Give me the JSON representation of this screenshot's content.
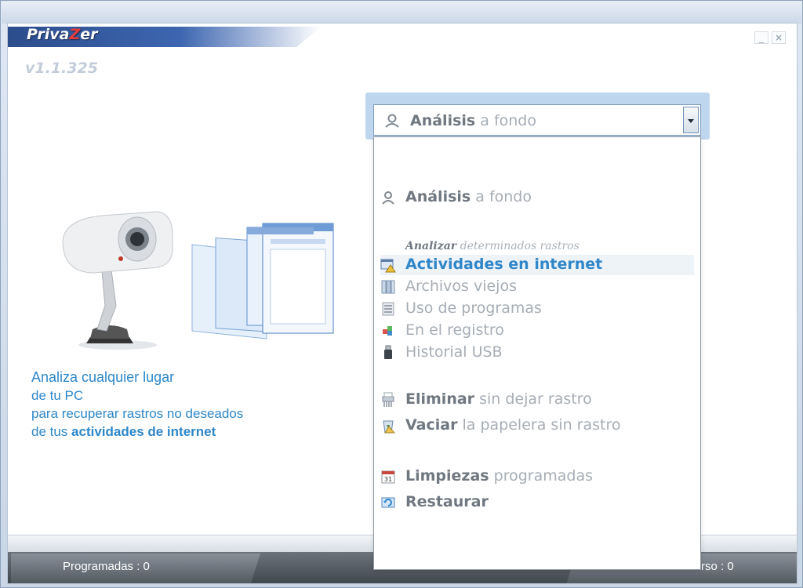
{
  "app": {
    "name_prefix": "Priva",
    "name_z": "Z",
    "name_suffix": "er",
    "version": "v1.1.325"
  },
  "window_controls": {
    "minimize": "_",
    "close": "×"
  },
  "promo": {
    "line1": "Analiza cualquier lugar",
    "line2": "de tu PC",
    "line3": "para recuperar rastros no deseados",
    "line4_prefix": "de tus",
    "line4_strong": "actividades de internet"
  },
  "combo": {
    "selected_bold": "Análisis",
    "selected_rest": "a fondo"
  },
  "dropdown": {
    "deep_scan": {
      "bold": "Análisis",
      "rest": "a fondo",
      "icon": "search-person-icon"
    },
    "heading": {
      "bold": "Analizar",
      "rest": "determinados rastros"
    },
    "items": [
      {
        "label": "Actividades en internet",
        "icon": "browser-warning-icon",
        "selected": true
      },
      {
        "label": "Archivos viejos",
        "icon": "files-icon"
      },
      {
        "label": "Uso de programas",
        "icon": "program-icon"
      },
      {
        "label": "En el registro",
        "icon": "registry-icon"
      },
      {
        "label": "Historial USB",
        "icon": "usb-icon"
      }
    ],
    "delete": {
      "bold": "Eliminar",
      "rest": "sin dejar rastro",
      "icon": "shredder-icon"
    },
    "empty_bin": {
      "bold": "Vaciar",
      "rest": "la papelera sin rastro",
      "icon": "recycle-bin-icon"
    },
    "scheduled": {
      "bold": "Limpiezas",
      "rest": "programadas",
      "icon": "calendar-icon"
    },
    "restore": {
      "label": "Restaurar",
      "icon": "restore-icon"
    }
  },
  "status": {
    "left": "Programadas : 0",
    "right": "rso : 0"
  },
  "colors": {
    "accent": "#2f86c8",
    "brand_bar": "#3d66b0",
    "status_bar": "#4a5058"
  }
}
